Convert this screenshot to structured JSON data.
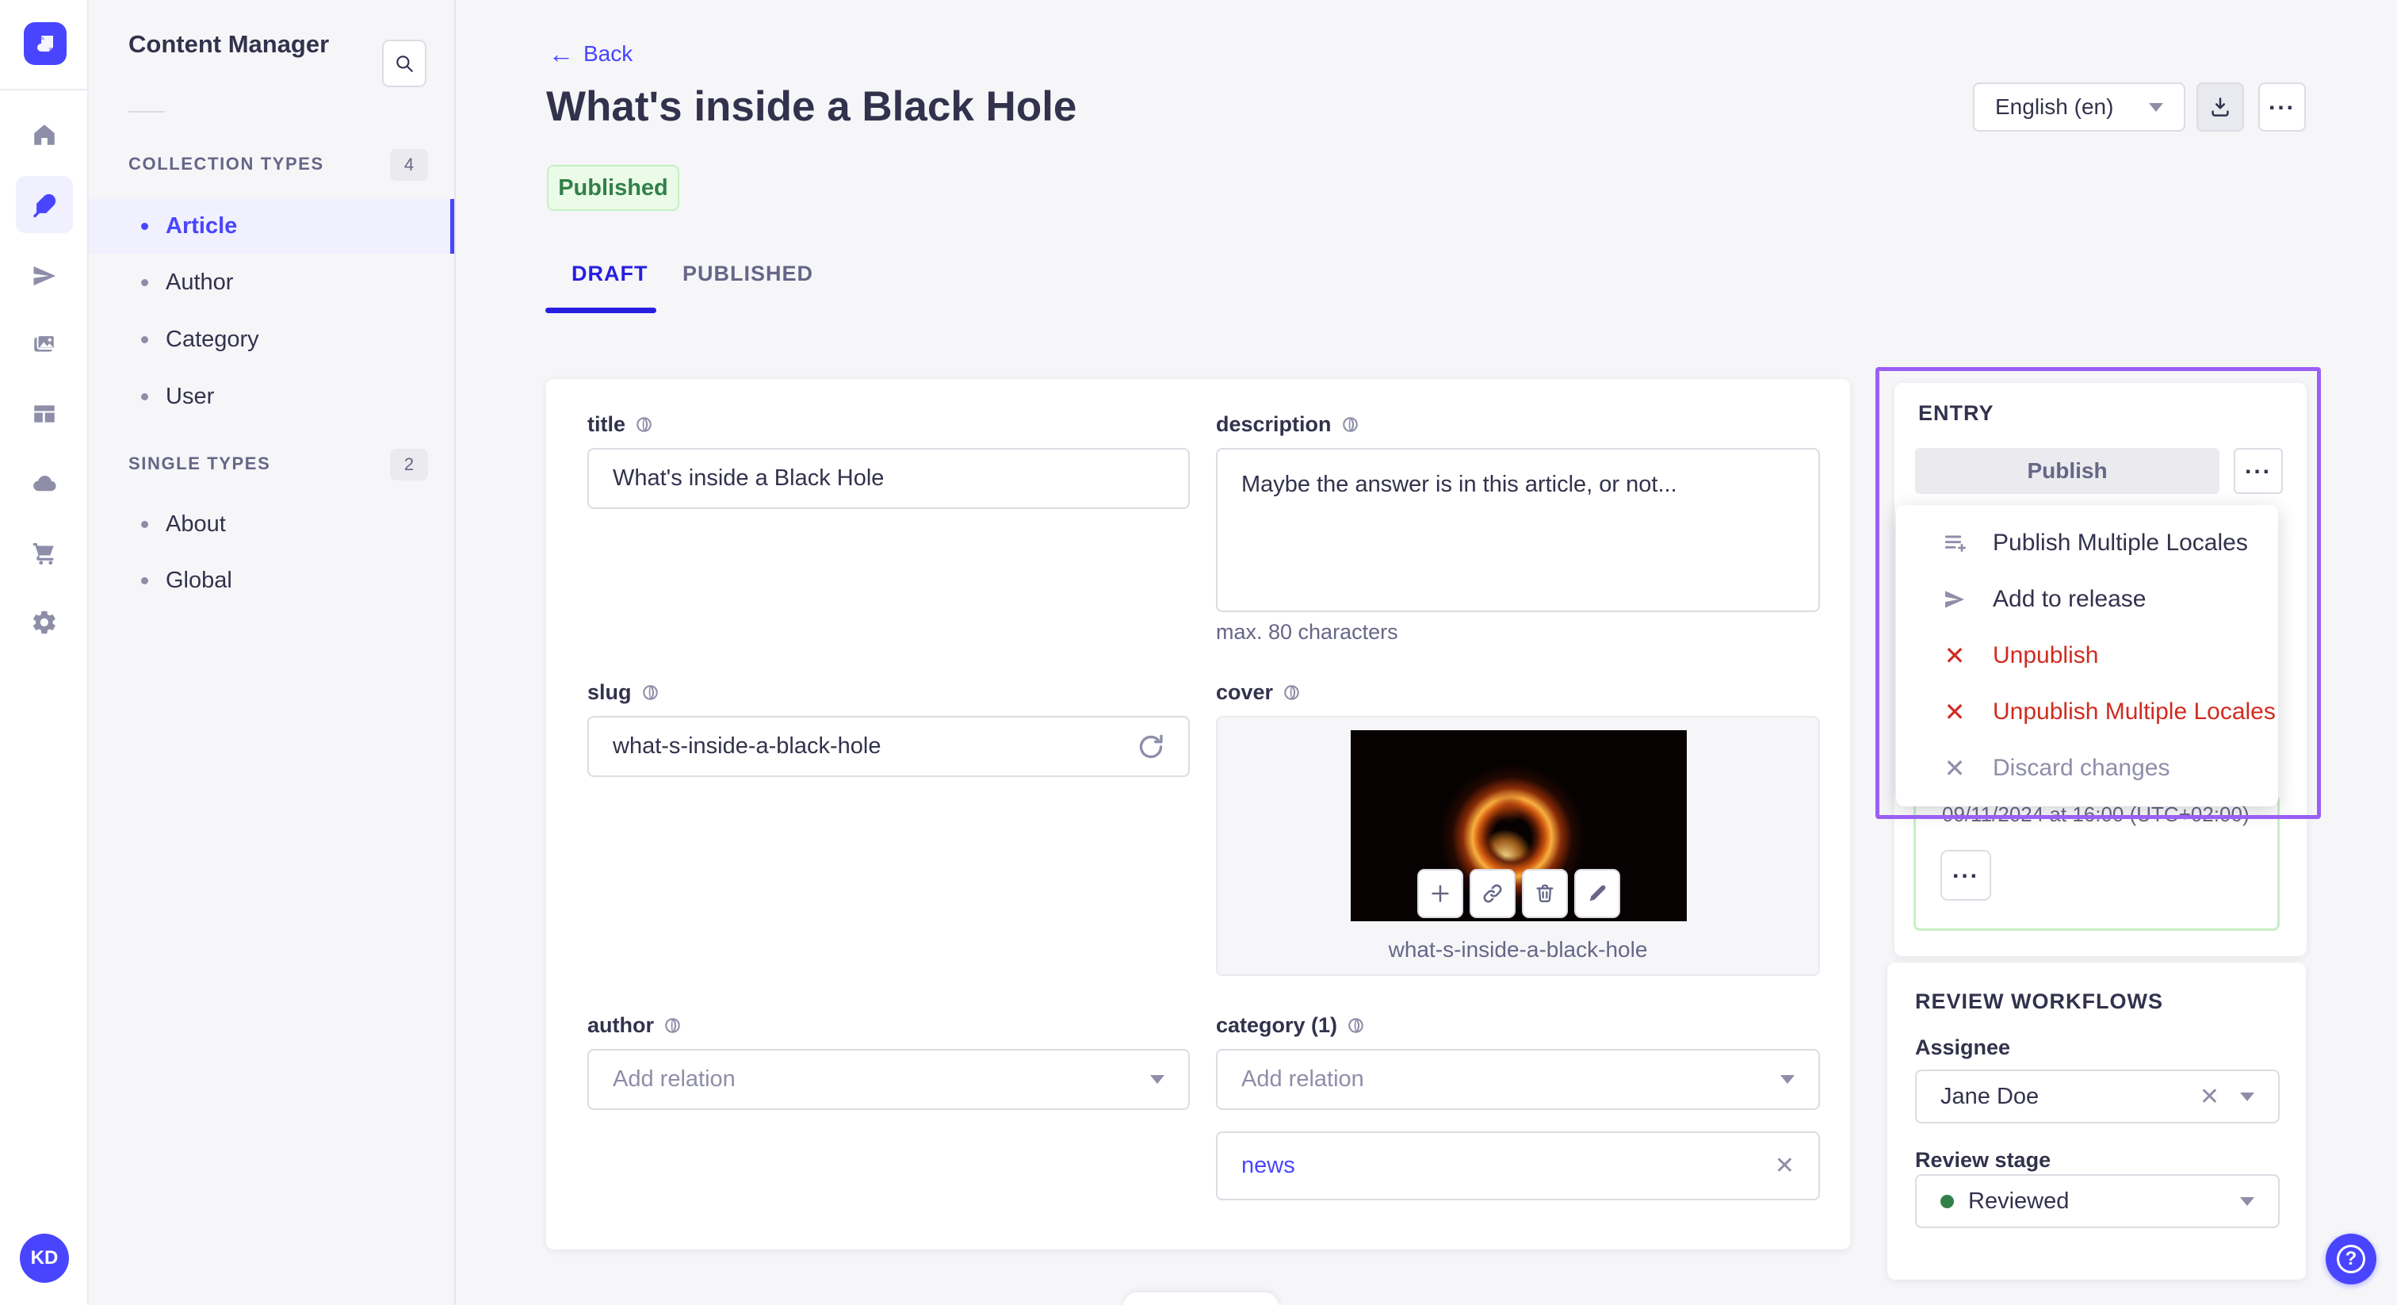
{
  "app": {
    "logo": "strapi",
    "avatar_initials": "KD"
  },
  "nav_rail": {
    "icons": [
      "home",
      "feather",
      "paper-plane",
      "media",
      "layout",
      "cloud",
      "cart",
      "settings"
    ],
    "active_icon": "feather"
  },
  "sidebar": {
    "title": "Content Manager",
    "sections": [
      {
        "label": "COLLECTION TYPES",
        "count": "4",
        "items": [
          {
            "label": "Article",
            "active": true
          },
          {
            "label": "Author"
          },
          {
            "label": "Category"
          },
          {
            "label": "User"
          }
        ]
      },
      {
        "label": "SINGLE TYPES",
        "count": "2",
        "items": [
          {
            "label": "About"
          },
          {
            "label": "Global"
          }
        ]
      }
    ]
  },
  "header": {
    "back_label": "Back",
    "back_arrow": "←",
    "title": "What's inside a Black Hole",
    "status_badge": "Published",
    "locale_select": "English (en)",
    "tabs": [
      {
        "label": "DRAFT",
        "active": true
      },
      {
        "label": "PUBLISHED",
        "active": false
      }
    ]
  },
  "form": {
    "title": {
      "label": "title",
      "value": "What's inside a Black Hole"
    },
    "description": {
      "label": "description",
      "value": "Maybe the answer is in this article, or not...",
      "hint": "max. 80 characters"
    },
    "slug": {
      "label": "slug",
      "value": "what-s-inside-a-black-hole"
    },
    "cover": {
      "label": "cover",
      "caption": "what-s-inside-a-black-hole",
      "actions": [
        "add",
        "copy-link",
        "delete",
        "edit"
      ]
    },
    "author": {
      "label": "author",
      "placeholder": "Add relation"
    },
    "category": {
      "label": "category (1)",
      "placeholder": "Add relation",
      "relations": [
        {
          "label": "news"
        }
      ]
    }
  },
  "entry_panel": {
    "heading": "ENTRY",
    "publish_label": "Publish",
    "menu": [
      {
        "label": "Publish Multiple Locales",
        "icon": "list-plus",
        "style": "default"
      },
      {
        "label": "Add to release",
        "icon": "paper-plane",
        "style": "default"
      },
      {
        "label": "Unpublish",
        "icon": "cross",
        "style": "danger"
      },
      {
        "label": "Unpublish Multiple Locales",
        "icon": "cross",
        "style": "danger"
      },
      {
        "label": "Discard changes",
        "icon": "cross",
        "style": "disabled"
      }
    ],
    "scheduled_date": "09/11/2024 at 16:00 (UTC+02:00)"
  },
  "review_panel": {
    "heading": "REVIEW WORKFLOWS",
    "assignee": {
      "label": "Assignee",
      "value": "Jane Doe"
    },
    "review_stage": {
      "label": "Review stage",
      "value": "Reviewed",
      "dot_color": "#328048"
    }
  },
  "colors": {
    "primary": "#4945ff",
    "tab_active": "#271fe0",
    "danger": "#d02b20",
    "success_text": "#328048",
    "success_border": "#c6f0c2",
    "success_bg": "#eafbe7",
    "highlight_outline": "#9a5ff5",
    "text_dark": "#32324d",
    "text_gray": "#666687",
    "text_light": "#8e8ea9"
  }
}
